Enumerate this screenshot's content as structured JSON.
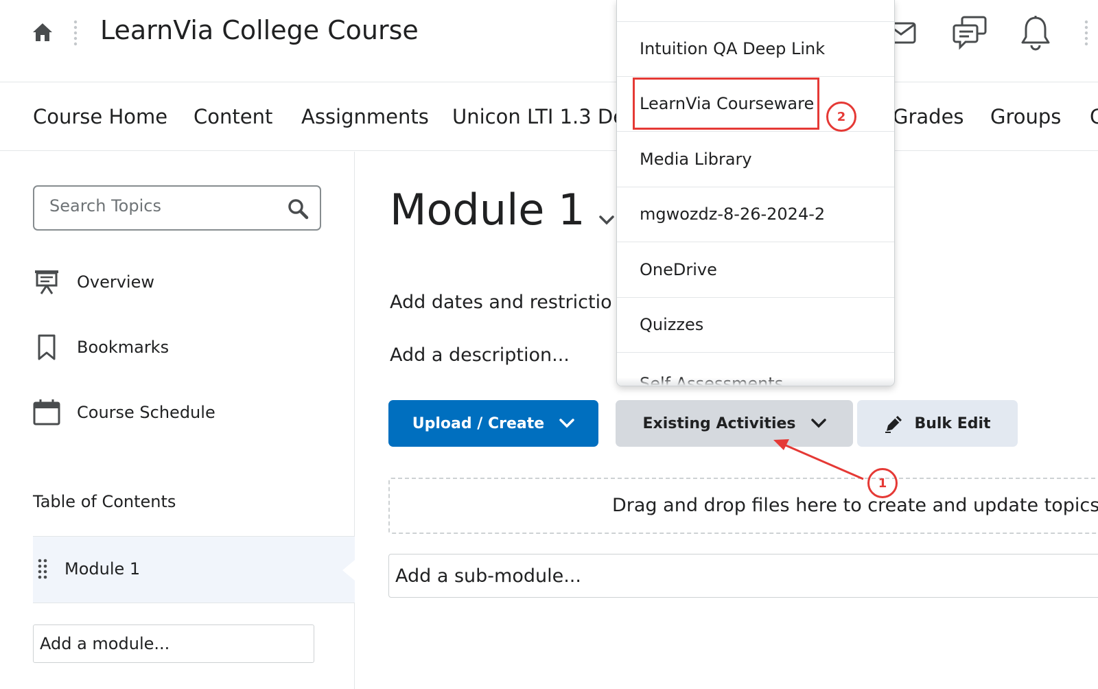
{
  "header": {
    "course_title": "LearnVia College Course"
  },
  "nav": {
    "items": [
      "Course Home",
      "Content",
      "Assignments",
      "Unicon LTI 1.3 De",
      "Grades",
      "Groups",
      "C"
    ]
  },
  "sidebar": {
    "search_placeholder": "Search Topics",
    "links": {
      "overview": "Overview",
      "bookmarks": "Bookmarks",
      "schedule": "Course Schedule"
    },
    "toc_title": "Table of Contents",
    "toc_item": "Module 1",
    "add_module_placeholder": "Add a module..."
  },
  "main": {
    "module_title": "Module 1",
    "add_dates": "Add dates and restrictio",
    "add_description": "Add a description...",
    "buttons": {
      "upload_create": "Upload / Create",
      "existing_activities": "Existing Activities",
      "bulk_edit": "Bulk Edit"
    },
    "dropzone_text": "Drag and drop files here to create and update topics",
    "add_submodule_placeholder": "Add a sub-module..."
  },
  "dropdown": {
    "items": [
      "Intuition QA Deep Link",
      "LearnVia Courseware",
      "Media Library",
      "mgwozdz-8-26-2024-2",
      "OneDrive",
      "Quizzes",
      "Self Assessments"
    ],
    "selected": "LearnVia Courseware"
  },
  "annotations": {
    "step1": "1",
    "step2": "2",
    "color": "#e53935"
  },
  "colors": {
    "primary": "#006fbf",
    "secondary_button": "#d5d9de",
    "tertiary_button": "#e3e9f1",
    "toc_selected_bg": "#f1f5fb"
  }
}
